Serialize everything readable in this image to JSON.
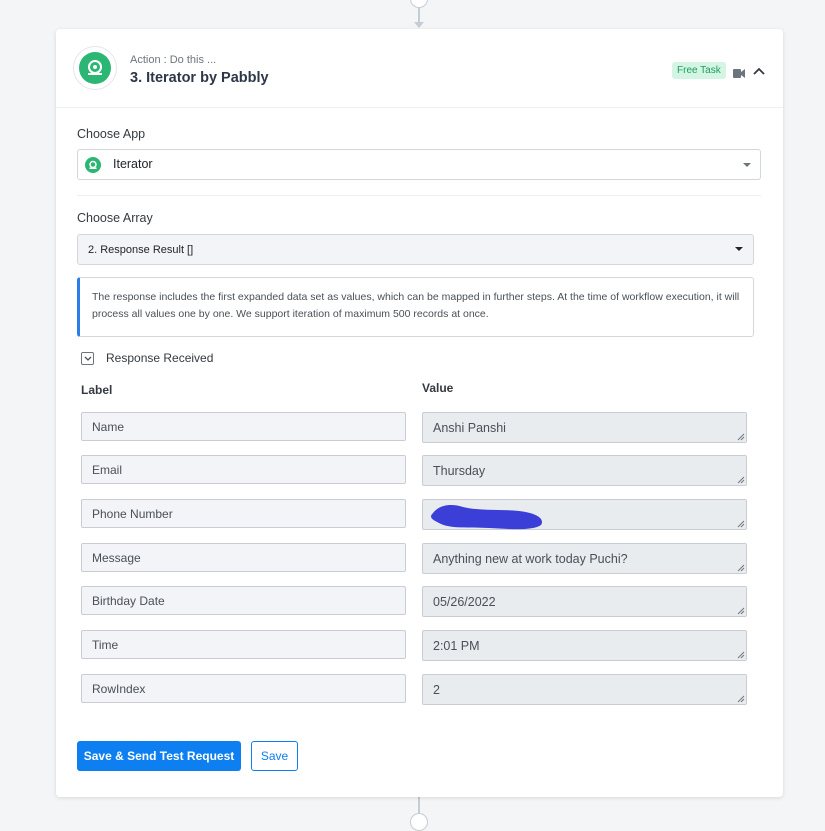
{
  "header": {
    "action_label": "Action : Do this ...",
    "title": "3. Iterator by Pabbly",
    "badge": "Free Task",
    "icons": {
      "app": "iterator-logo-icon",
      "video": "video-camera-icon",
      "collapse": "chevron-up-icon"
    }
  },
  "choose_app": {
    "label": "Choose App",
    "value": "Iterator"
  },
  "choose_array": {
    "label": "Choose Array",
    "value": "2. Response Result []"
  },
  "info": {
    "text": "The response includes the first expanded data set as values, which can be mapped in further steps. At the time of workflow execution, it will process all values one by one. We support iteration of maximum 500 records at once."
  },
  "response": {
    "label": "Response Received",
    "columns": {
      "label": "Label",
      "value": "Value"
    },
    "rows": [
      {
        "label": "Name",
        "value": "Anshi Panshi"
      },
      {
        "label": "Email",
        "value": "Thursday"
      },
      {
        "label": "Phone Number",
        "value": ""
      },
      {
        "label": "Message",
        "value": "Anything new at work today Puchi?"
      },
      {
        "label": "Birthday Date",
        "value": "05/26/2022"
      },
      {
        "label": "Time",
        "value": "2:01 PM"
      },
      {
        "label": "RowIndex",
        "value": "2"
      }
    ]
  },
  "buttons": {
    "save_send": "Save & Send Test Request",
    "save": "Save"
  },
  "colors": {
    "accent": "#0d7ff0",
    "success": "#2bb673",
    "badge_bg": "#d4f5e4",
    "info_border": "#2b7de9"
  }
}
